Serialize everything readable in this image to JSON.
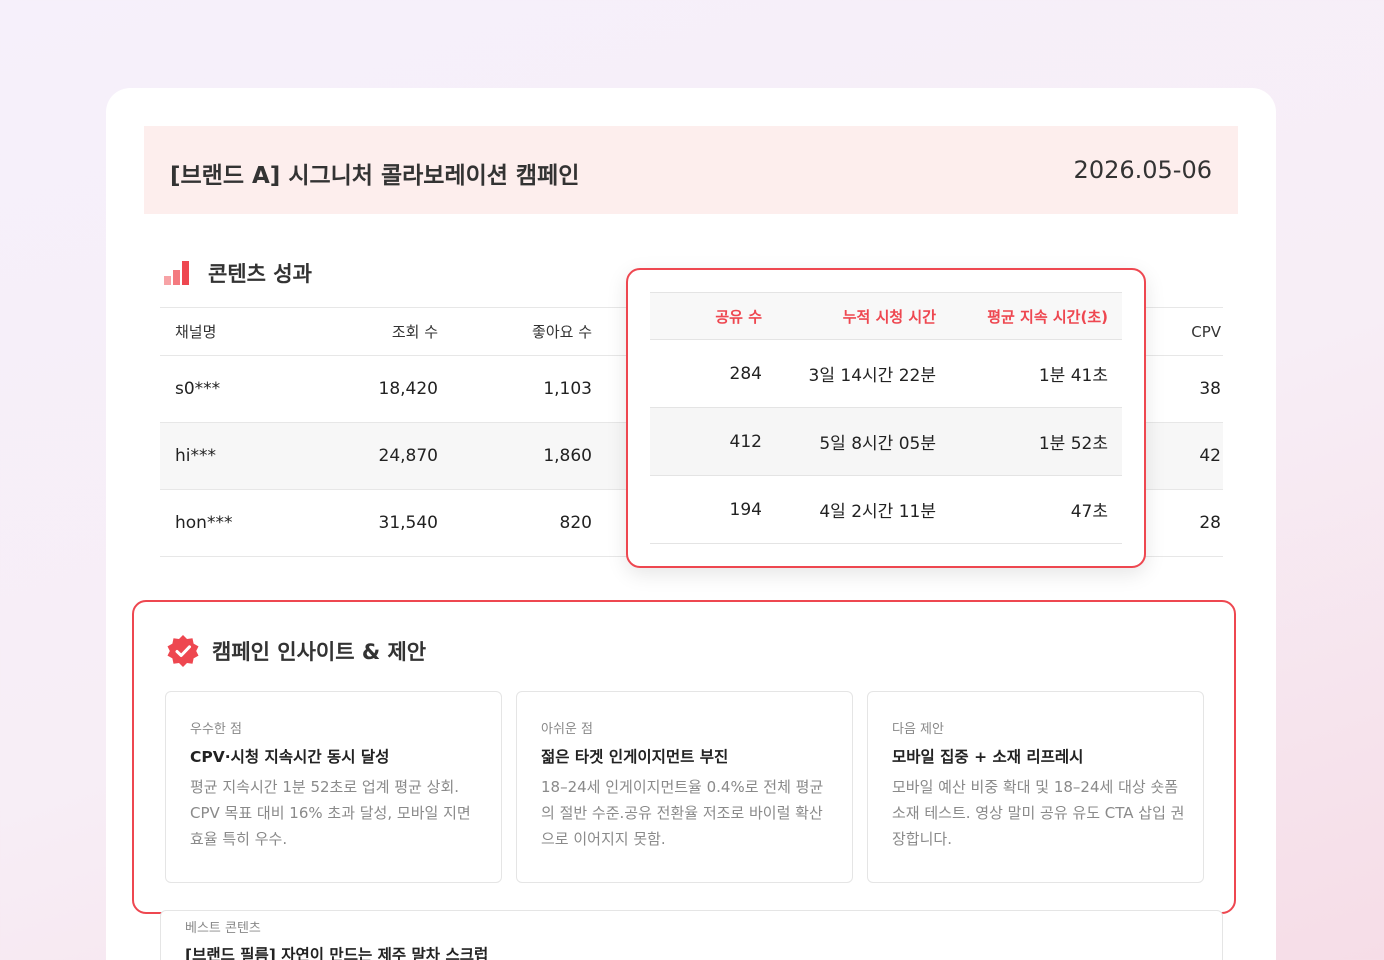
{
  "header": {
    "title": "[브랜드 A] 시그니처 콜라보레이션 캠페인",
    "date": "2026.05-06"
  },
  "content_section": {
    "title": "콘텐츠 성과",
    "icon": "bar-chart-icon"
  },
  "table": {
    "headers": {
      "channel": "채널명",
      "views": "조회 수",
      "likes": "좋아요 수",
      "cpv": "CPV"
    },
    "rows": [
      {
        "channel": "s0***",
        "views": "18,420",
        "likes": "1,103",
        "cpv": "38"
      },
      {
        "channel": "hi***",
        "views": "24,870",
        "likes": "1,860",
        "cpv": "42"
      },
      {
        "channel": "hon***",
        "views": "31,540",
        "likes": "820",
        "cpv": "28"
      }
    ]
  },
  "highlight_table": {
    "headers": {
      "shares": "공유 수",
      "cumulative": "누적 시청 시간",
      "avg_duration": "평균 지속 시간(초)"
    },
    "rows": [
      {
        "shares": "284",
        "cumulative": "3일 14시간 22분",
        "avg_duration": "1분 41초"
      },
      {
        "shares": "412",
        "cumulative": "5일 8시간 05분",
        "avg_duration": "1분 52초"
      },
      {
        "shares": "194",
        "cumulative": "4일 2시간 11분",
        "avg_duration": "47초"
      }
    ]
  },
  "insights": {
    "title": "캠페인 인사이트 & 제안",
    "icon": "verified-badge-icon",
    "cards": [
      {
        "label": "우수한 점",
        "title": "CPV·시청 지속시간 동시 달성",
        "body": "평균 지속시간 1분 52초로 업계 평균 상회. CPV 목표 대비 16% 초과 달성, 모바일 지면 효율 특히 우수."
      },
      {
        "label": "아쉬운 점",
        "title": "젊은 타겟 인게이지먼트 부진",
        "body": "18–24세 인게이지먼트율 0.4%로 전체 평균의 절반 수준.공유 전환율 저조로 바이럴 확산으로 이어지지 못함."
      },
      {
        "label": "다음 제안",
        "title": "모바일 집중 + 소재 리프레시",
        "body": "모바일 예산 비중 확대 및 18–24세 대상 숏폼 소재 테스트. 영상 말미 공유 유도 CTA 삽입 권장합니다."
      }
    ]
  },
  "best_content": {
    "label": "베스트 콘텐츠",
    "title": "[브랜드 필름] 자연이 만드는 제주 말차 스크럽"
  },
  "colors": {
    "accent": "#ee4750",
    "accent_light": "#f7a3a6",
    "header_bg": "#fdeeed"
  }
}
